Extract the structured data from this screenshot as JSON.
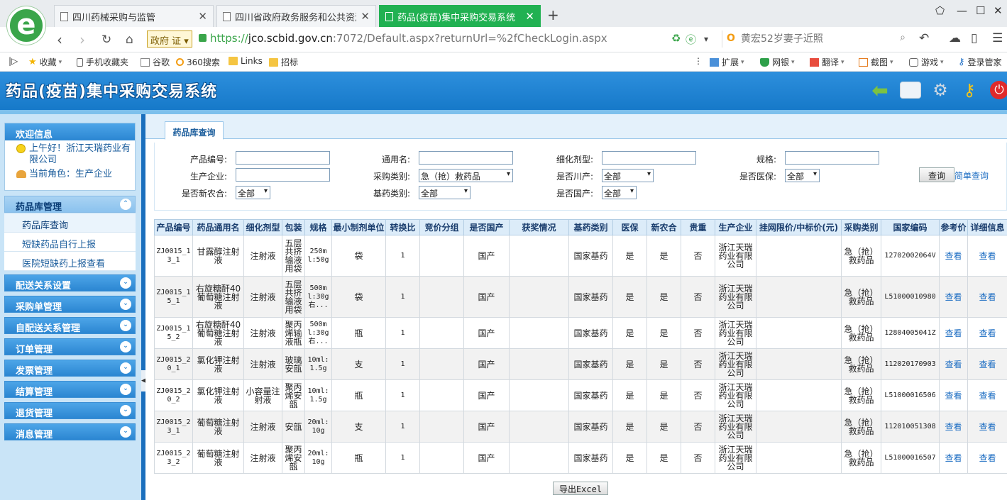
{
  "browser": {
    "tabs": [
      {
        "label": "四川药械采购与监管"
      },
      {
        "label": "四川省政府政务服务和公共资源交易服务中心"
      },
      {
        "label": "药品(疫苗)集中采购交易系统"
      }
    ],
    "gov_badge": "政府",
    "url_scheme": "https://",
    "url_host": "jco.scbid.gov.cn",
    "url_rest": ":7072/Default.aspx?returnUrl=%2fCheckLogin.aspx",
    "search_placeholder": "黄宏52岁妻子近照",
    "bookmarks": [
      "收藏",
      "手机收藏夹",
      "谷歌",
      "360搜索",
      "Links",
      "招标"
    ],
    "tools": [
      "扩展",
      "网银",
      "翻译",
      "截图",
      "游戏",
      "登录管家"
    ]
  },
  "app": {
    "title": "药品(疫苗)集中采购交易系统"
  },
  "sidebar": {
    "welcome_title": "欢迎信息",
    "greeting": "上午好！浙江天瑞药业有限公司",
    "role": "当前角色：生产企业",
    "menus": [
      {
        "label": "药品库管理",
        "open": true,
        "items": [
          {
            "label": "药品库查询"
          },
          {
            "label": "短缺药品自行上报"
          },
          {
            "label": "医院短缺药上报查看"
          }
        ]
      },
      {
        "label": "配送关系设置"
      },
      {
        "label": "采购单管理"
      },
      {
        "label": "自配送关系管理"
      },
      {
        "label": "订单管理"
      },
      {
        "label": "发票管理"
      },
      {
        "label": "结算管理"
      },
      {
        "label": "退货管理"
      },
      {
        "label": "消息管理"
      }
    ]
  },
  "main": {
    "tab_label": "药品库查询",
    "form": {
      "product_code_label": "产品编号:",
      "generic_name_label": "通用名:",
      "dosage_form_label": "细化剂型:",
      "spec_label": "规格:",
      "manufacturer_label": "生产企业:",
      "purchase_type_label": "采购类别:",
      "purchase_type_value": "急（抢）救药品",
      "sichuan_label": "是否川产:",
      "sichuan_value": "全部",
      "insurance_label": "是否医保:",
      "insurance_value": "全部",
      "ncms_label": "是否新农合:",
      "ncms_value": "全部",
      "essential_label": "基药类别:",
      "essential_value": "全部",
      "domestic_label": "是否国产:",
      "domestic_value": "全部",
      "query_button": "查询",
      "simple_query": "简单查询"
    },
    "table": {
      "headers": [
        "产品编号",
        "药品通用名",
        "细化剂型",
        "包装",
        "规格",
        "最小制剂单位",
        "转换比",
        "竞价分组",
        "是否国产",
        "获奖情况",
        "基药类别",
        "医保",
        "新农合",
        "贵重",
        "生产企业",
        "挂网限价/中标价(元)",
        "采购类别",
        "国家编码",
        "参考价",
        "详细信息"
      ],
      "rows": [
        [
          "ZJ0015_13_1",
          "甘露醇注射液",
          "注射液",
          "五层共挤输液用袋",
          "250ml:50g",
          "袋",
          "1",
          "",
          "国产",
          "",
          "国家基药",
          "是",
          "是",
          "否",
          "浙江天瑞药业有限公司",
          "",
          "急（抢）救药品",
          "12702002064V",
          "查看",
          "查看"
        ],
        [
          "ZJ0015_15_1",
          "右旋糖酐40葡萄糖注射液",
          "注射液",
          "五层共挤输液用袋",
          "500ml:30g右...",
          "袋",
          "1",
          "",
          "国产",
          "",
          "国家基药",
          "是",
          "是",
          "否",
          "浙江天瑞药业有限公司",
          "",
          "急（抢）救药品",
          "L51000010980",
          "查看",
          "查看"
        ],
        [
          "ZJ0015_15_2",
          "右旋糖酐40葡萄糖注射液",
          "注射液",
          "聚丙烯输液瓶",
          "500ml:30g右...",
          "瓶",
          "1",
          "",
          "国产",
          "",
          "国家基药",
          "是",
          "是",
          "否",
          "浙江天瑞药业有限公司",
          "",
          "急（抢）救药品",
          "12804005041Z",
          "查看",
          "查看"
        ],
        [
          "ZJ0015_20_1",
          "氯化钾注射液",
          "注射液",
          "玻璃安瓿",
          "10ml:1.5g",
          "支",
          "1",
          "",
          "国产",
          "",
          "国家基药",
          "是",
          "是",
          "否",
          "浙江天瑞药业有限公司",
          "",
          "急（抢）救药品",
          "112020170903",
          "查看",
          "查看"
        ],
        [
          "ZJ0015_20_2",
          "氯化钾注射液",
          "小容量注射液",
          "聚丙烯安瓿",
          "10ml:1.5g",
          "瓶",
          "1",
          "",
          "国产",
          "",
          "国家基药",
          "是",
          "是",
          "否",
          "浙江天瑞药业有限公司",
          "",
          "急（抢）救药品",
          "L51000016506",
          "查看",
          "查看"
        ],
        [
          "ZJ0015_23_1",
          "葡萄糖注射液",
          "注射液",
          "安瓿",
          "20ml:10g",
          "支",
          "1",
          "",
          "国产",
          "",
          "国家基药",
          "是",
          "是",
          "否",
          "浙江天瑞药业有限公司",
          "",
          "急（抢）救药品",
          "112010051308",
          "查看",
          "查看"
        ],
        [
          "ZJ0015_23_2",
          "葡萄糖注射液",
          "注射液",
          "聚丙烯安瓿",
          "20ml:10g",
          "瓶",
          "1",
          "",
          "国产",
          "",
          "国家基药",
          "是",
          "是",
          "否",
          "浙江天瑞药业有限公司",
          "",
          "急（抢）救药品",
          "L51000016507",
          "查看",
          "查看"
        ]
      ]
    },
    "export_button": "导出Excel"
  }
}
